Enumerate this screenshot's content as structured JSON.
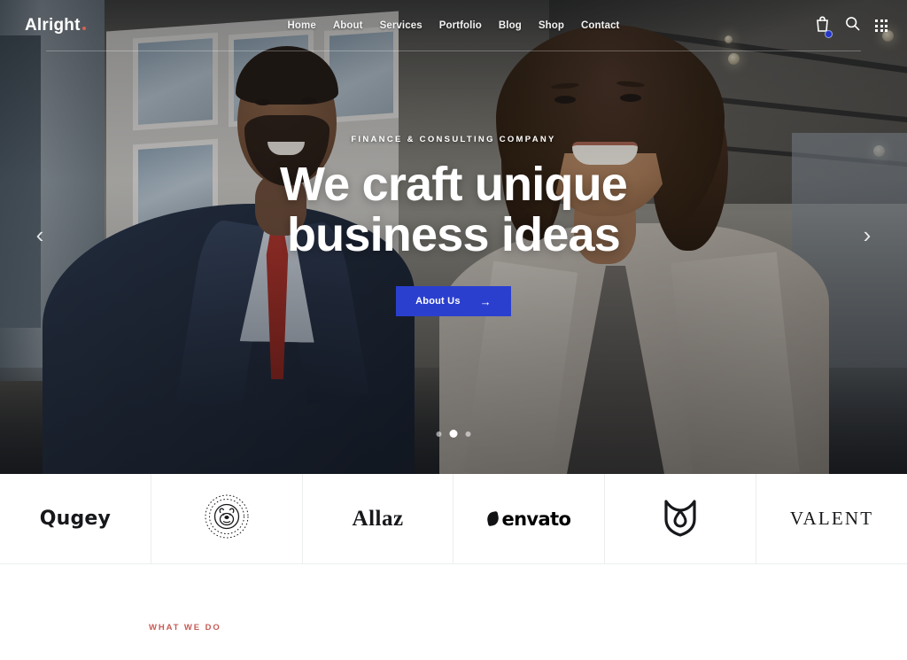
{
  "header": {
    "logo_text": "Alright",
    "nav": [
      {
        "label": "Home",
        "active": true
      },
      {
        "label": "About",
        "active": false
      },
      {
        "label": "Services",
        "active": false
      },
      {
        "label": "Portfolio",
        "active": false
      },
      {
        "label": "Blog",
        "active": false
      },
      {
        "label": "Shop",
        "active": false
      },
      {
        "label": "Contact",
        "active": false
      }
    ],
    "icons": {
      "cart": "cart-icon",
      "search": "search-icon",
      "grid": "grid-menu-icon"
    }
  },
  "hero": {
    "eyebrow": "FINANCE & CONSULTING COMPANY",
    "headline_line1": "We craft unique",
    "headline_line2": "business ideas",
    "cta_label": "About Us",
    "cta_arrow": "→",
    "cta_color": "#2b3fcf",
    "prev_arrow": "‹",
    "next_arrow": "›",
    "slides_total": 3,
    "slide_active": 2
  },
  "clients": [
    {
      "name": "Qugey",
      "style": "wordmark"
    },
    {
      "name": "BULLDOG",
      "style": "badge"
    },
    {
      "name": "Allaz",
      "style": "wordmark"
    },
    {
      "name": "envato",
      "style": "wordmark-leaf"
    },
    {
      "name": "",
      "style": "shield-mark"
    },
    {
      "name": "VALENT",
      "style": "wordmark"
    }
  ],
  "section": {
    "what_we_do_label": "WHAT WE DO",
    "accent_color": "#c75b55"
  }
}
